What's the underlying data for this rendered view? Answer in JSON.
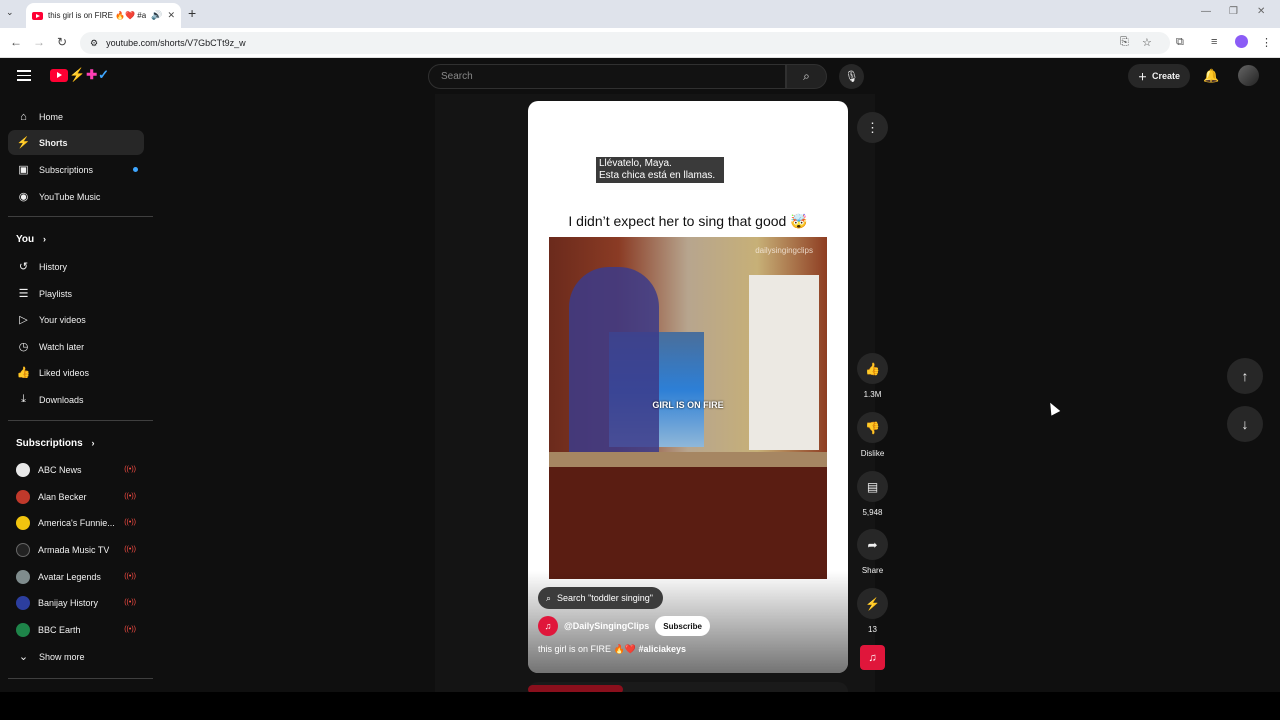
{
  "browser": {
    "tab_title": "this girl is on FIRE 🔥❤️ #ali",
    "new_tab": "+",
    "url": "youtube.com/shorts/V7GbCTt9z_w",
    "icons": {
      "back": "arrow-left-icon",
      "forward": "arrow-right-icon",
      "reload": "reload-icon",
      "site_info": "tune-icon"
    }
  },
  "masthead": {
    "search_placeholder": "Search",
    "create_label": "Create",
    "icons": {
      "menu": "hamburger-icon",
      "search": "search-icon",
      "mic": "mic-icon",
      "bell": "bell-icon"
    }
  },
  "sidebar": {
    "main": [
      {
        "label": "Home",
        "icon": "⌂"
      },
      {
        "label": "Shorts",
        "icon": "⚡"
      },
      {
        "label": "Subscriptions",
        "icon": "▣"
      },
      {
        "label": "YouTube Music",
        "icon": "◉"
      }
    ],
    "you_heading": "You",
    "you_items": [
      {
        "label": "History",
        "icon": "↺"
      },
      {
        "label": "Playlists",
        "icon": "☰"
      },
      {
        "label": "Your videos",
        "icon": "▷"
      },
      {
        "label": "Watch later",
        "icon": "◷"
      },
      {
        "label": "Liked videos",
        "icon": "👍"
      },
      {
        "label": "Downloads",
        "icon": "⤓"
      }
    ],
    "subs_heading": "Subscriptions",
    "subs": [
      {
        "label": "ABC News",
        "color": "#e8e8e8"
      },
      {
        "label": "Alan Becker",
        "color": "#c0392b"
      },
      {
        "label": "America's Funnie...",
        "color": "#f1c40f"
      },
      {
        "label": "Armada Music TV",
        "color": "#222222"
      },
      {
        "label": "Avatar Legends",
        "color": "#7f8c8d"
      },
      {
        "label": "Banijay History",
        "color": "#2c3e9e"
      },
      {
        "label": "BBC Earth",
        "color": "#1e8449"
      }
    ],
    "show_more": "Show more"
  },
  "short": {
    "caption_line1": "Llévatelo, Maya.",
    "caption_line2": "Esta chica está en llamas.",
    "headline": "I didn’t expect her to sing that good 🤯",
    "watermark": "dailysingingclips",
    "overlay_text": "GIRL IS ON FIRE",
    "search_chip": "Search \"toddler singing\"",
    "channel": "@DailySingingClips",
    "subscribe": "Subscribe",
    "title": "this girl is on FIRE 🔥❤️",
    "hashtag": "#aliciakeys"
  },
  "actions": {
    "likes": "1.3M",
    "dislike": "Dislike",
    "comments": "5,948",
    "share": "Share",
    "remix": "13"
  }
}
